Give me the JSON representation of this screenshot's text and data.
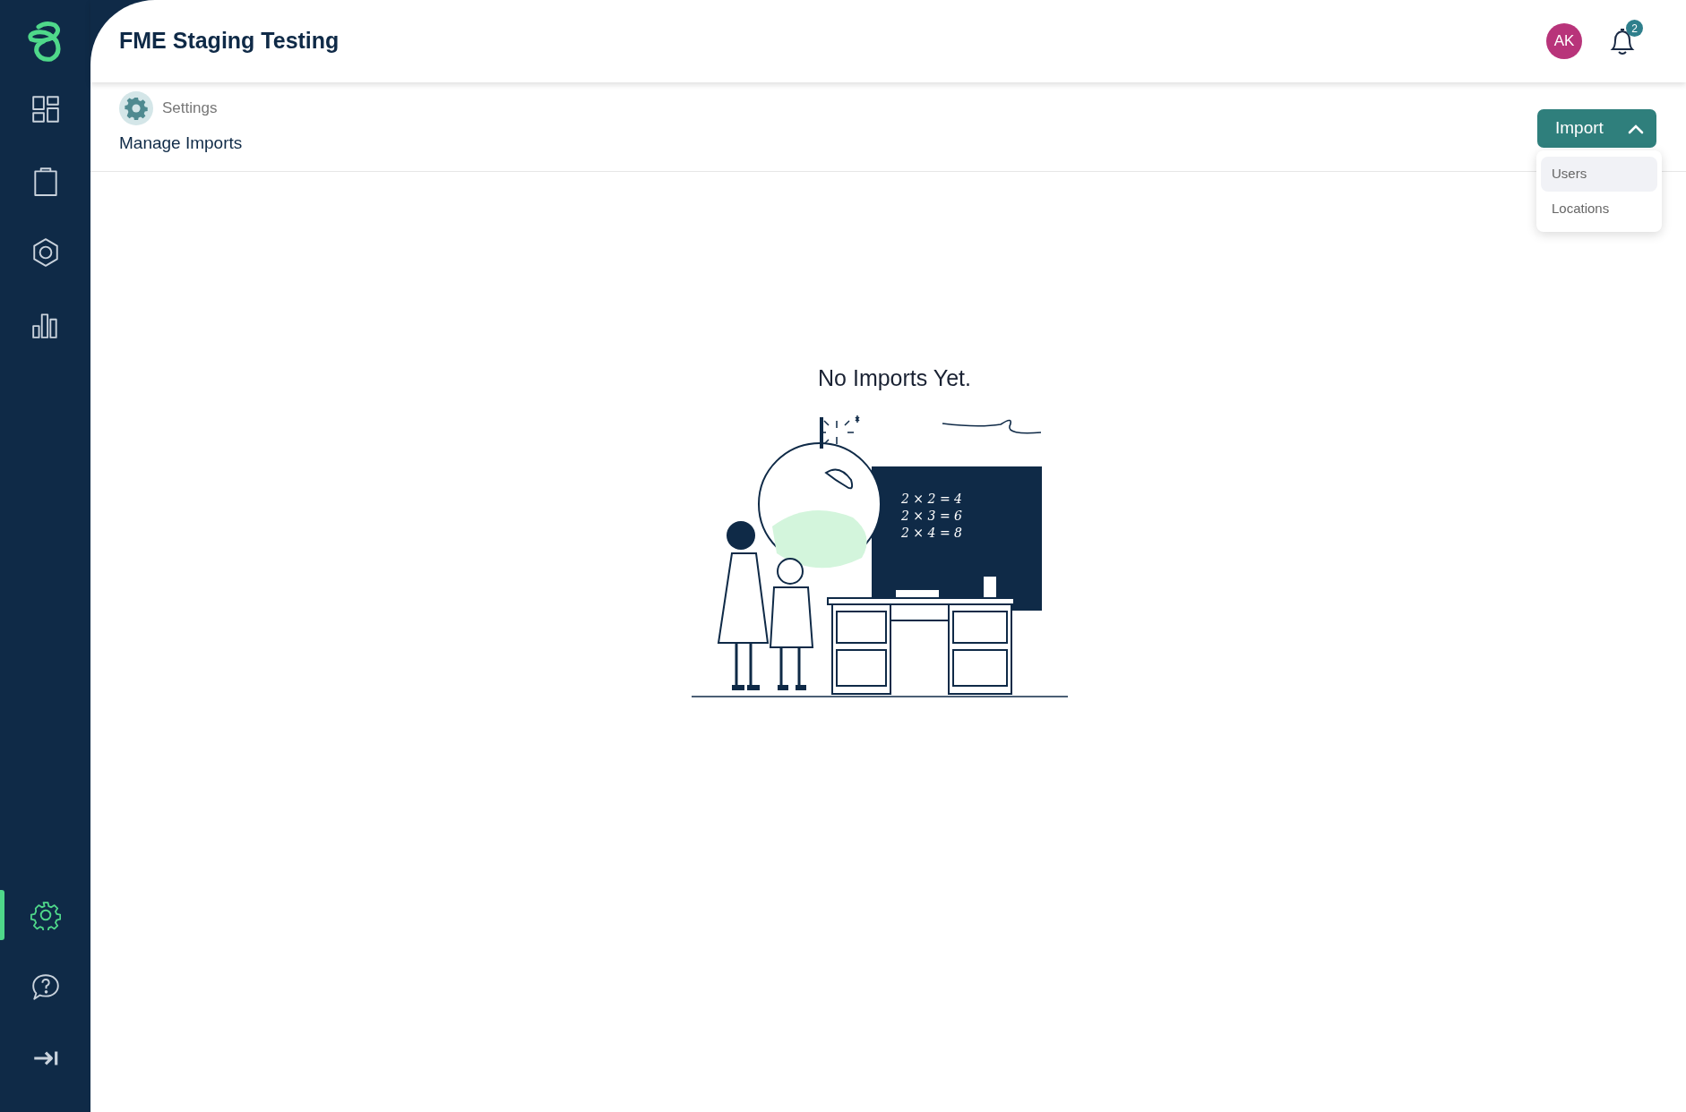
{
  "sidebar": {
    "items": [
      {
        "kind": "dashboard",
        "selected": false
      },
      {
        "kind": "clipboard",
        "selected": false
      },
      {
        "kind": "hexagon",
        "selected": false
      },
      {
        "kind": "chart",
        "selected": false
      }
    ],
    "bottom_items": [
      {
        "kind": "settings",
        "selected": true
      },
      {
        "kind": "help",
        "selected": false
      },
      {
        "kind": "collapse",
        "selected": false
      }
    ]
  },
  "header": {
    "title": "FME Staging Testing",
    "avatar": "AK",
    "notifications": "2"
  },
  "breadcrumb": {
    "parent": "Settings",
    "current": "Manage Imports"
  },
  "import_button": {
    "label": "Import",
    "expanded": true,
    "menu": [
      {
        "label": "Users",
        "highlighted": true
      },
      {
        "label": "Locations",
        "highlighted": false
      }
    ]
  },
  "empty_state": {
    "message": "No Imports Yet.",
    "board_lines": [
      "2 × 2 = 4",
      "2 × 3 = 6",
      "2 × 4 = 8"
    ]
  }
}
